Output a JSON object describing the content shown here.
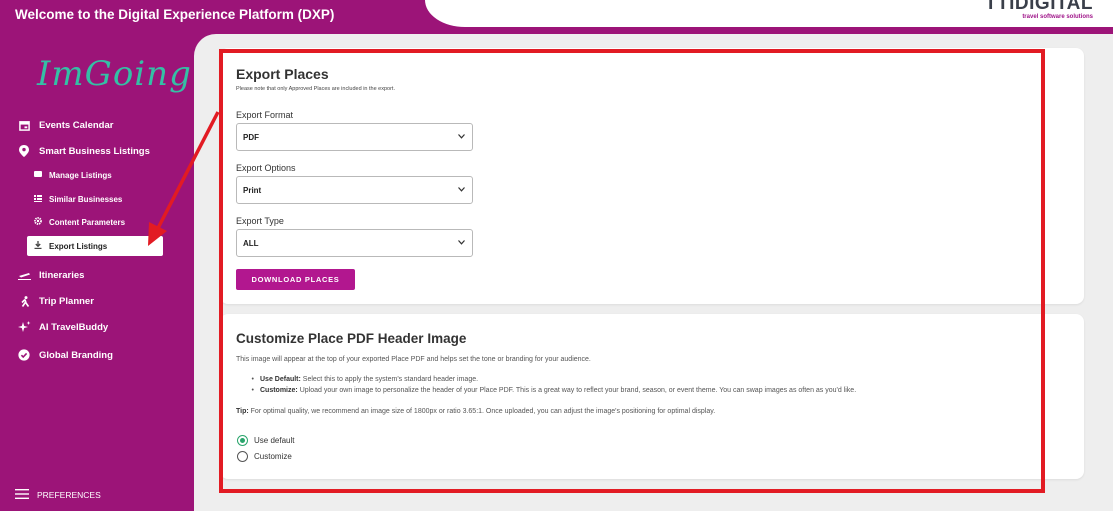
{
  "header": {
    "title": "Welcome to the Digital Experience Platform (DXP)",
    "brand_name": "TTIDIGITAL",
    "brand_tagline": "travel software solutions"
  },
  "sidebar": {
    "app_name": "ImGoing",
    "items": [
      {
        "label": "Events Calendar",
        "icon": "calendar-icon"
      },
      {
        "label": "Smart Business Listings",
        "icon": "map-pin-icon"
      },
      {
        "label": "Itineraries",
        "icon": "plane-icon"
      },
      {
        "label": "Trip Planner",
        "icon": "walk-icon"
      },
      {
        "label": "AI TravelBuddy",
        "icon": "sparkle-icon"
      },
      {
        "label": "Global Branding",
        "icon": "verified-badge-icon"
      }
    ],
    "subitems": [
      {
        "label": "Manage Listings",
        "icon": "card-icon"
      },
      {
        "label": "Similar Businesses",
        "icon": "grid-icon"
      },
      {
        "label": "Content Parameters",
        "icon": "gear-icon"
      },
      {
        "label": "Export Listings",
        "icon": "download-icon"
      }
    ],
    "preferences": "PREFERENCES"
  },
  "export": {
    "title": "Export Places",
    "note": "Please note that only Approved Places are included in the export.",
    "format_label": "Export Format",
    "format_value": "PDF",
    "options_label": "Export Options",
    "options_value": "Print",
    "type_label": "Export Type",
    "type_value": "ALL",
    "download_label": "DOWNLOAD PLACES"
  },
  "customize": {
    "title": "Customize Place PDF Header Image",
    "description": "This image will appear at the top of your exported Place PDF and helps set the tone or branding for your audience.",
    "bullet1_strong": "Use Default:",
    "bullet1_text": "Select this to apply the system's standard header image.",
    "bullet2_strong": "Customize:",
    "bullet2_text": "Upload your own image to personalize the header of your Place PDF. This is a great way to reflect your brand, season, or event theme. You can swap images as often as you'd like.",
    "tip_strong": "Tip:",
    "tip_text": "For optimal quality, we recommend an image size of 1800px or ratio 3.65:1. Once uploaded, you can adjust the image's positioning for optimal display.",
    "radio_default": "Use default",
    "radio_customize": "Customize"
  },
  "colors": {
    "brand": "#9c1478",
    "button": "#b2178f",
    "accent": "#35bfa5",
    "annotation": "#e21b23"
  }
}
